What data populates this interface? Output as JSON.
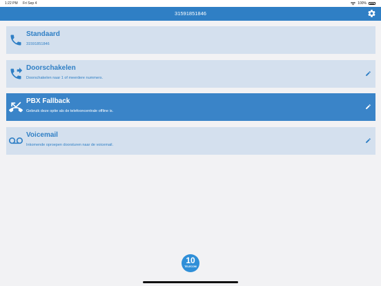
{
  "status_bar": {
    "time": "1:22 PM",
    "date": "Fri Sep 4",
    "battery": "100%"
  },
  "header": {
    "title": "31591851846",
    "settings_icon": "gear-icon"
  },
  "colors": {
    "brand": "#2f7fc5",
    "active_card": "#3a84c8",
    "card": "#d4e0ee"
  },
  "options": [
    {
      "title": "Standaard",
      "subtitle": "31591851846",
      "icon": "phone-icon",
      "active": false,
      "editable": false
    },
    {
      "title": "Doorschakelen",
      "subtitle": "Doorschakelen naar 1 of meerdere nummers.",
      "icon": "call-forward-icon",
      "active": false,
      "editable": true
    },
    {
      "title": "PBX Fallback",
      "subtitle": "Gebruik deze optie als de telefooncentrale offline is.",
      "icon": "call-missed-icon",
      "active": true,
      "editable": true
    },
    {
      "title": "Voicemail",
      "subtitle": "Inkomende oproepen doorsturen naar de voicemail.",
      "icon": "voicemail-icon",
      "active": false,
      "editable": true
    }
  ],
  "logo": {
    "number": "10",
    "text": "TELECOM"
  }
}
